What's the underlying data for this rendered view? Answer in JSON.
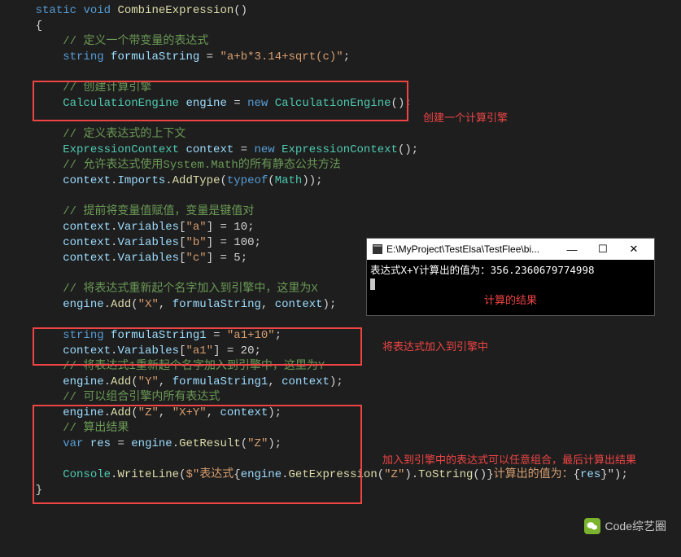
{
  "code": {
    "l0": "{",
    "l1_kw1": "static",
    "l1_kw2": "void",
    "l1_method": "CombineExpression",
    "l1_p": "()",
    "l2": "{",
    "l3_c": "// 定义一个带变量的表达式",
    "l4_kw": "string",
    "l4_var": "formulaString",
    "l4_eq": " = ",
    "l4_str": "\"a+b*3.14+sqrt(c)\"",
    "l4_end": ";",
    "l5": "",
    "l6_c": "// 创建计算引擎",
    "l7_type1": "CalculationEngine",
    "l7_var": "engine",
    "l7_eq": " = ",
    "l7_kw": "new",
    "l7_type2": "CalculationEngine",
    "l7_p": "();",
    "l8": "",
    "l9_c": "// 定义表达式的上下文",
    "l10_type1": "ExpressionContext",
    "l10_var": "context",
    "l10_eq": " = ",
    "l10_kw": "new",
    "l10_type2": "ExpressionContext",
    "l10_p": "();",
    "l11_c": "// 允许表达式使用System.Math的所有静态公共方法",
    "l12_var": "context",
    "l12_p1": ".",
    "l12_prop": "Imports",
    "l12_p2": ".",
    "l12_method": "AddType",
    "l12_p3": "(",
    "l12_kw": "typeof",
    "l12_p4": "(",
    "l12_type": "Math",
    "l12_p5": "));",
    "l13": "",
    "l14_c": "// 提前将变量值赋值，变量是键值对",
    "l15_var": "context",
    "l15_p1": ".",
    "l15_prop": "Variables",
    "l15_p2": "[",
    "l15_str": "\"a\"",
    "l15_p3": "] = 10;",
    "l16_var": "context",
    "l16_p1": ".",
    "l16_prop": "Variables",
    "l16_p2": "[",
    "l16_str": "\"b\"",
    "l16_p3": "] = 100;",
    "l17_var": "context",
    "l17_p1": ".",
    "l17_prop": "Variables",
    "l17_p2": "[",
    "l17_str": "\"c\"",
    "l17_p3": "] = 5;",
    "l18": "",
    "l19_c": "// 将表达式重新起个名字加入到引擎中，这里为X",
    "l20_var": "engine",
    "l20_p1": ".",
    "l20_method": "Add",
    "l20_p2": "(",
    "l20_str": "\"X\"",
    "l20_p3": ", ",
    "l20_var2": "formulaString",
    "l20_p4": ", ",
    "l20_var3": "context",
    "l20_p5": ");",
    "l21": "",
    "l22_kw": "string",
    "l22_var": "formulaString1",
    "l22_eq": " = ",
    "l22_str": "\"a1+10\"",
    "l22_end": ";",
    "l23_var": "context",
    "l23_p1": ".",
    "l23_prop": "Variables",
    "l23_p2": "[",
    "l23_str": "\"a1\"",
    "l23_p3": "] = 20;",
    "l24_c": "// 将表达式1重新起个名字加入到引擎中，这里为Y",
    "l25_var": "engine",
    "l25_p1": ".",
    "l25_method": "Add",
    "l25_p2": "(",
    "l25_str": "\"Y\"",
    "l25_p3": ", ",
    "l25_var2": "formulaString1",
    "l25_p4": ", ",
    "l25_var3": "context",
    "l25_p5": ");",
    "l26_c": "// 可以组合引擎内所有表达式",
    "l27_var": "engine",
    "l27_p1": ".",
    "l27_method": "Add",
    "l27_p2": "(",
    "l27_str1": "\"Z\"",
    "l27_p3": ", ",
    "l27_str2": "\"X+Y\"",
    "l27_p4": ", ",
    "l27_var2": "context",
    "l27_p5": ");",
    "l28_c": "// 算出结果",
    "l29_kw": "var",
    "l29_var": "res",
    "l29_eq": " = ",
    "l29_var2": "engine",
    "l29_p1": ".",
    "l29_method": "GetResult",
    "l29_p2": "(",
    "l29_str": "\"Z\"",
    "l29_p3": ");",
    "l30": "",
    "l31_type": "Console",
    "l31_p1": ".",
    "l31_method": "WriteLine",
    "l31_p2": "(",
    "l31_str1": "$\"表达式",
    "l31_p3": "{",
    "l31_var": "engine",
    "l31_p4": ".",
    "l31_method2": "GetExpression",
    "l31_p5": "(",
    "l31_str2": "\"Z\"",
    "l31_p6": ").",
    "l31_method3": "ToString",
    "l31_p7": "()}",
    "l31_str3": "计算出的值为：",
    "l31_p8": "{",
    "l31_var2": "res",
    "l31_p9": "}\"",
    "l31_p10": ");",
    "l32": "}"
  },
  "annotations": {
    "a1": "创建一个计算引擎",
    "a2": "计算的结果",
    "a3": "将表达式加入到引擎中",
    "a4": "加入到引擎中的表达式可以任意组合，最后计算出结果"
  },
  "console": {
    "title": "E:\\MyProject\\TestElsa\\TestFlee\\bi...",
    "output": "表达式X+Y计算出的值为：356.2360679774998",
    "min": "—",
    "max": "☐",
    "close": "✕"
  },
  "watermark": "Code综艺圈"
}
